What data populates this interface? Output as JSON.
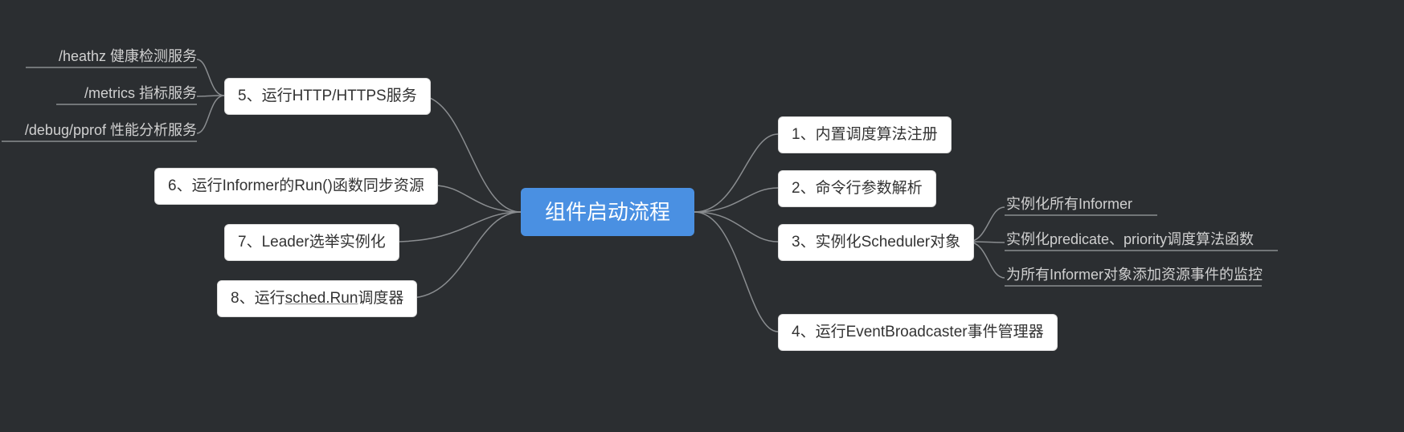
{
  "root": {
    "label": "组件启动流程"
  },
  "left": {
    "n5": {
      "label": "5、运行HTTP/HTTPS服务"
    },
    "n5_children": {
      "c1": "/heathz 健康检测服务",
      "c2": "/metrics 指标服务",
      "c3": "/debug/pprof 性能分析服务"
    },
    "n6": {
      "label": "6、运行Informer的Run()函数同步资源"
    },
    "n7": {
      "label": "7、Leader选举实例化"
    },
    "n8": {
      "label_pre": "8、运行",
      "label_mid": "sched.Run",
      "label_post": "调度器"
    }
  },
  "right": {
    "n1": {
      "label": "1、内置调度算法注册"
    },
    "n2": {
      "label": "2、命令行参数解析"
    },
    "n3": {
      "label": "3、实例化Scheduler对象"
    },
    "n3_children": {
      "c1": "实例化所有Informer",
      "c2": "实例化predicate、priority调度算法函数",
      "c3": "为所有Informer对象添加资源事件的监控"
    },
    "n4": {
      "label": "4、运行EventBroadcaster事件管理器"
    }
  }
}
